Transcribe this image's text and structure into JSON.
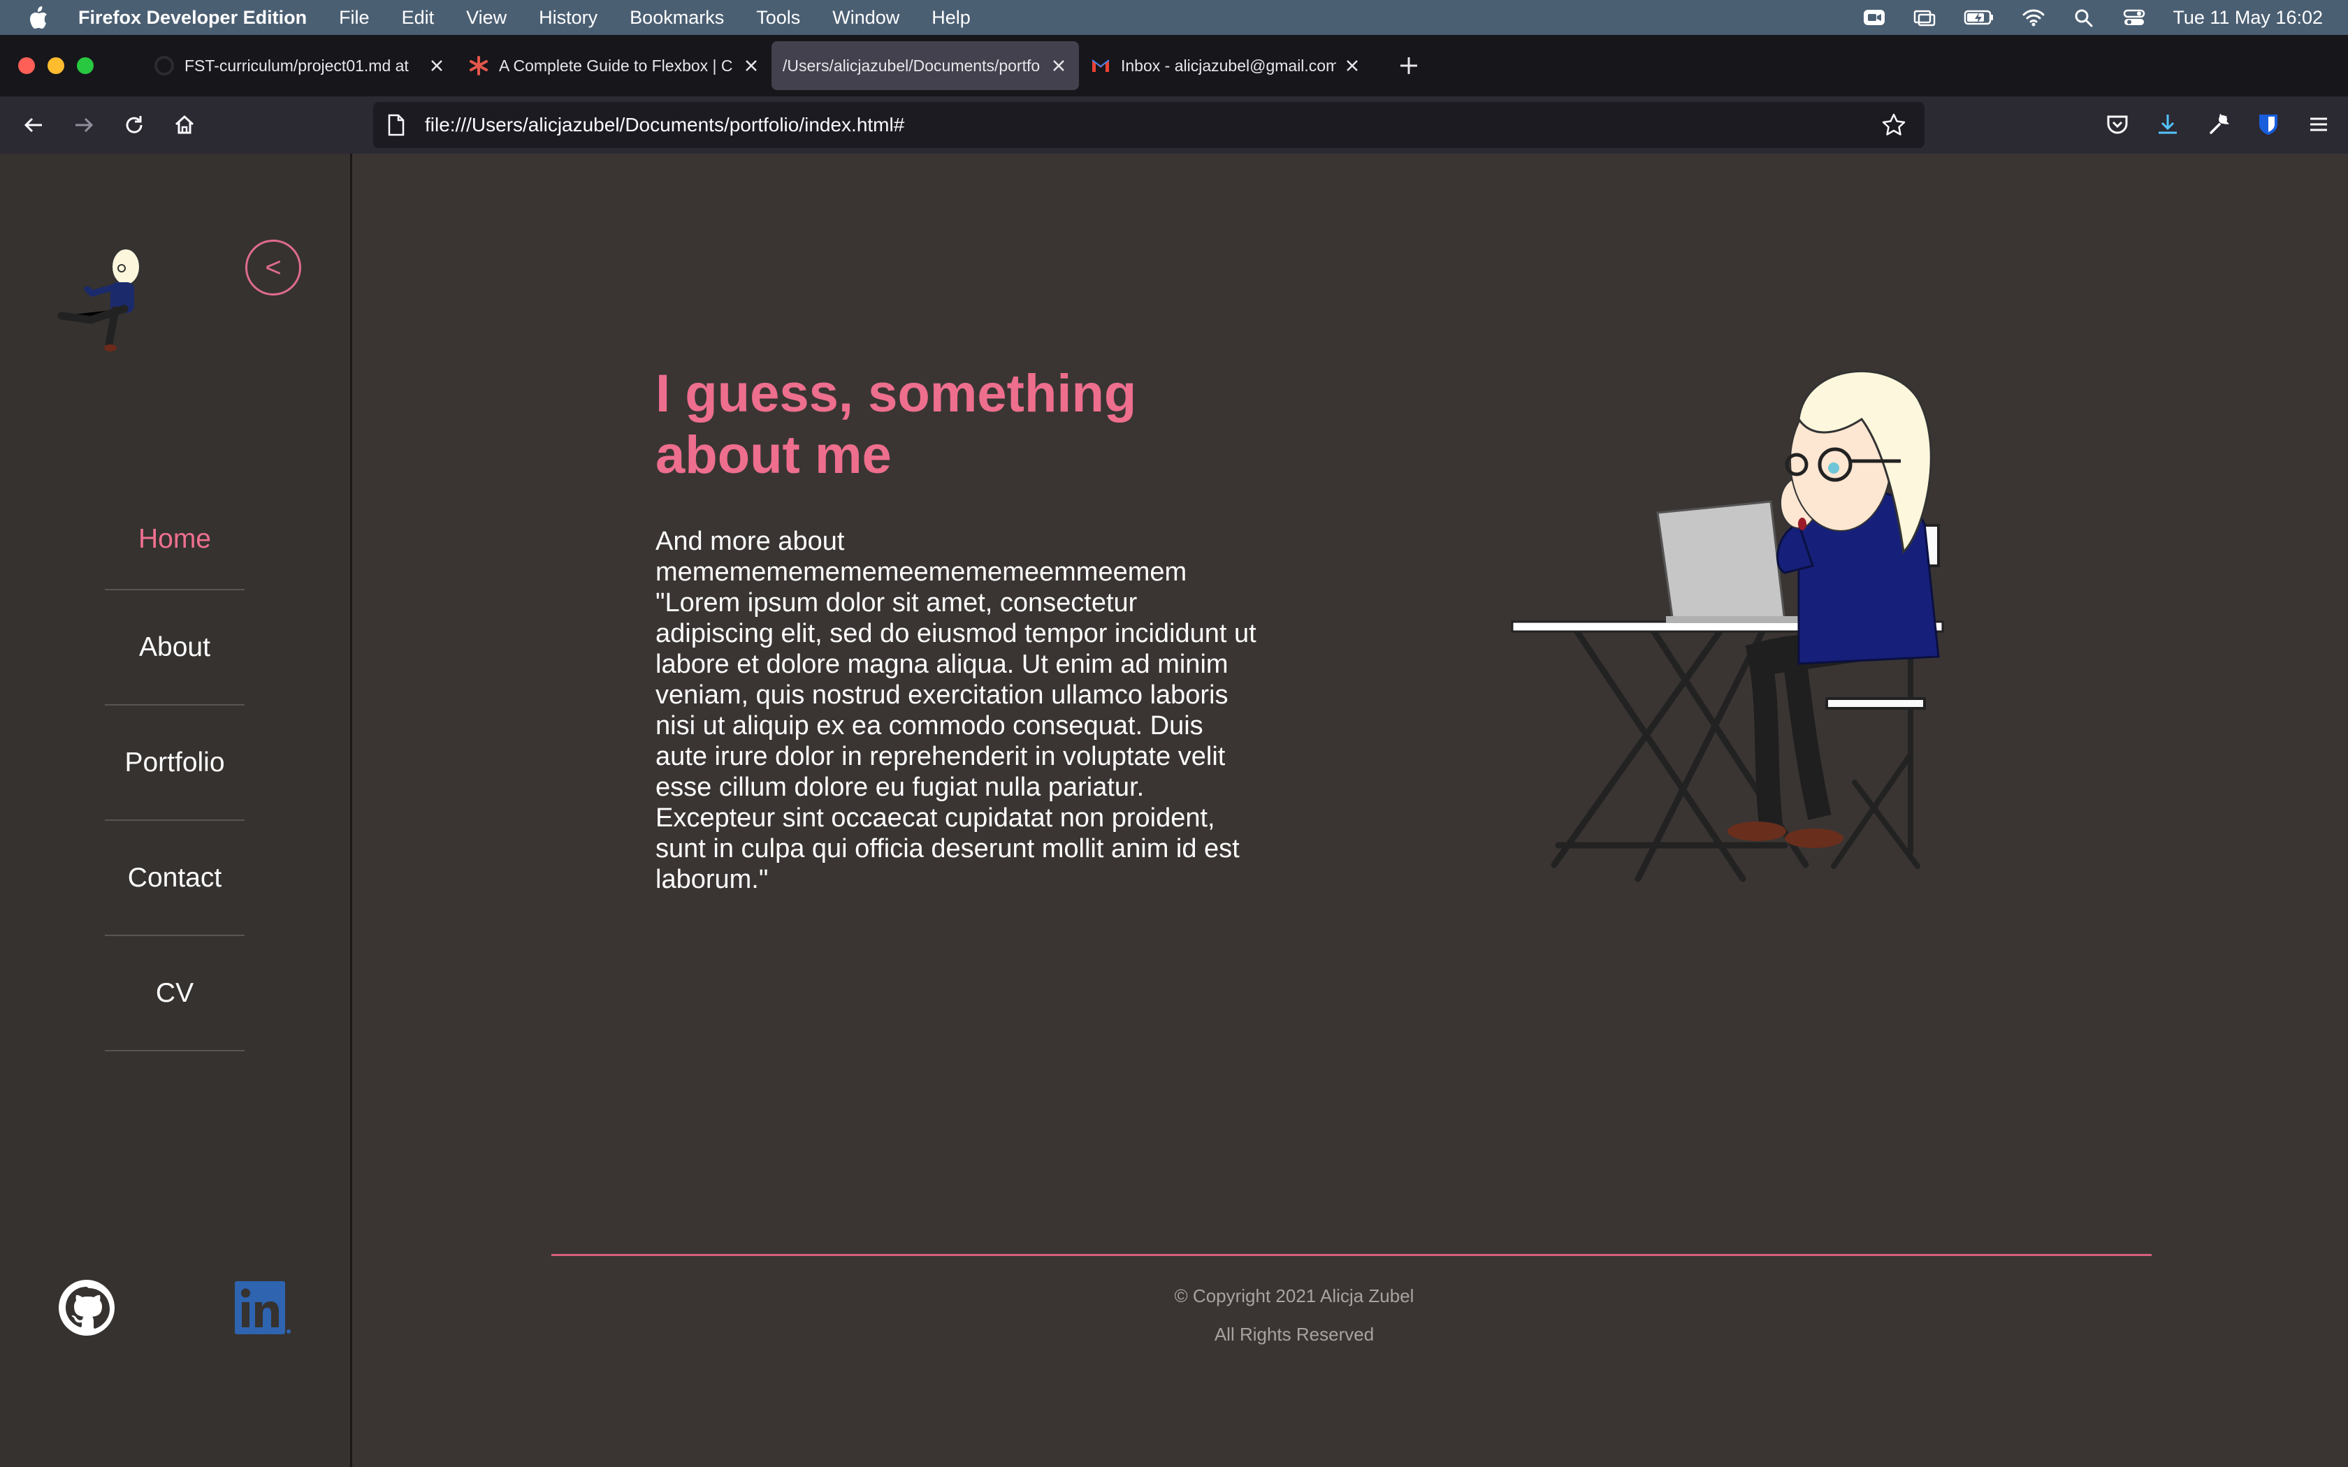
{
  "menubar": {
    "app_name": "Firefox Developer Edition",
    "items": [
      "File",
      "Edit",
      "View",
      "History",
      "Bookmarks",
      "Tools",
      "Window",
      "Help"
    ],
    "clock": "Tue 11 May  16:02"
  },
  "tabs": [
    {
      "title": "FST-curriculum/project01.md at",
      "icon": "github-icon"
    },
    {
      "title": "A Complete Guide to Flexbox | C",
      "icon": "css-tricks-icon"
    },
    {
      "title": "/Users/alicjazubel/Documents/portfo",
      "icon": "none",
      "active": true
    },
    {
      "title": "Inbox - alicjazubel@gmail.com -",
      "icon": "gmail-icon"
    }
  ],
  "url": "file:///Users/alicjazubel/Documents/portfolio/index.html#",
  "sidebar": {
    "collapse_label": "<",
    "nav": [
      {
        "label": "Home",
        "active": true
      },
      {
        "label": "About"
      },
      {
        "label": "Portfolio"
      },
      {
        "label": "Contact"
      },
      {
        "label": "CV"
      }
    ]
  },
  "main": {
    "heading": "I guess, something about me",
    "bio": "And more about mememememememeemememeemmeemem \"Lorem ipsum dolor sit amet, consectetur adipiscing elit, sed do eiusmod tempor incididunt ut labore et dolore magna aliqua. Ut enim ad minim veniam, quis nostrud exercitation ullamco laboris nisi ut aliquip ex ea commodo consequat. Duis aute irure dolor in reprehenderit in voluptate velit esse cillum dolore eu fugiat nulla pariatur. Excepteur sint occaecat cupidatat non proident, sunt in culpa qui officia deserunt mollit anim id est laborum.\""
  },
  "footer": {
    "copyright": "© Copyright 2021 Alicja Zubel",
    "rights": "All Rights Reserved"
  },
  "colors": {
    "accent": "#ee6e8e",
    "page_bg": "#3a3533",
    "sidebar_bg": "#363230"
  }
}
